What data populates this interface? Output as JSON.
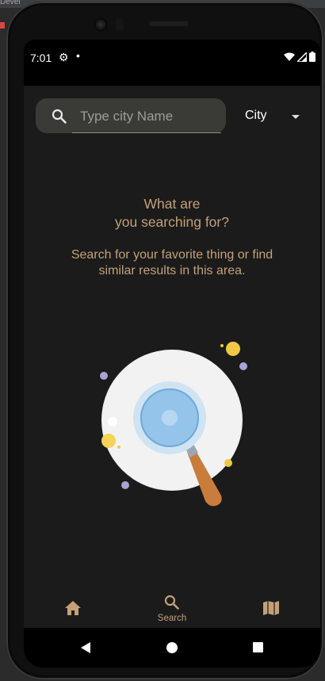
{
  "ide": {
    "text": "Devel"
  },
  "status_bar": {
    "time": "7:01",
    "icons": [
      "gear-icon",
      "notification-dot-icon",
      "wifi-icon",
      "signal-icon",
      "battery-icon"
    ]
  },
  "search": {
    "placeholder": "Type city Name",
    "value": ""
  },
  "dropdown": {
    "selected": "City"
  },
  "empty_state": {
    "title_line1": "What are",
    "title_line2": "you searching for?",
    "subtitle_line1": "Search for your favorite thing or find",
    "subtitle_line2": "similar results in this area."
  },
  "bottom_nav": {
    "items": [
      {
        "icon": "home-icon",
        "label": ""
      },
      {
        "icon": "search-icon",
        "label": "Search"
      },
      {
        "icon": "map-icon",
        "label": ""
      }
    ]
  },
  "colors": {
    "background": "#1b1b1b",
    "accent": "#c4a078",
    "search_box": "#3a3a36"
  }
}
